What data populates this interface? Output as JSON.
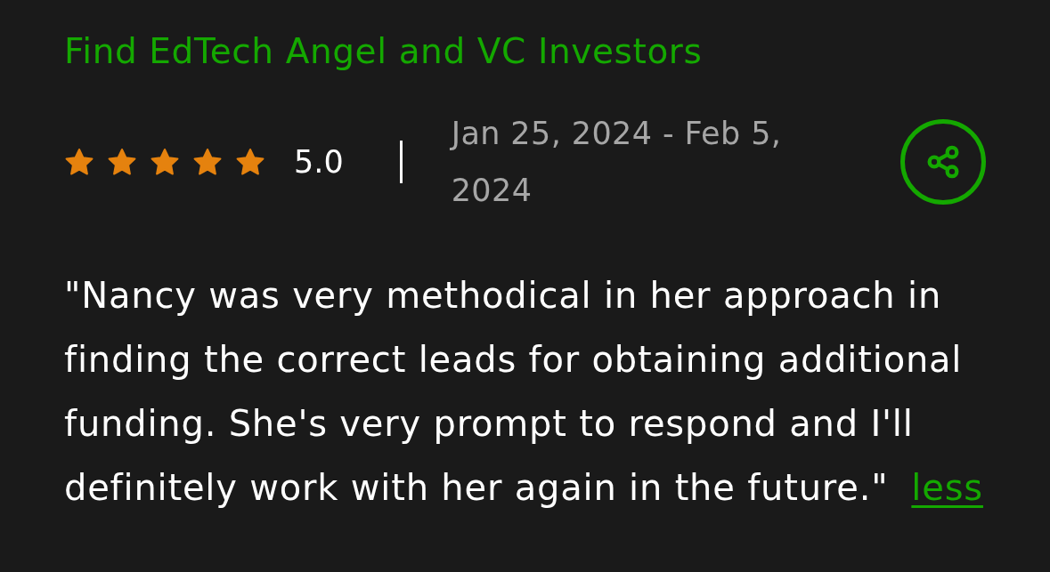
{
  "title": "Find EdTech Angel and VC Investors",
  "rating": {
    "stars": 5,
    "score": "5.0"
  },
  "date_range": "Jan 25, 2024 - Feb 5, 2024",
  "review": {
    "text": "\"Nancy was very methodical in her approach in finding the correct leads for obtaining additional funding. She's very prompt to respond and I'll definitely work with her again in the future.\"",
    "toggle": "less"
  }
}
